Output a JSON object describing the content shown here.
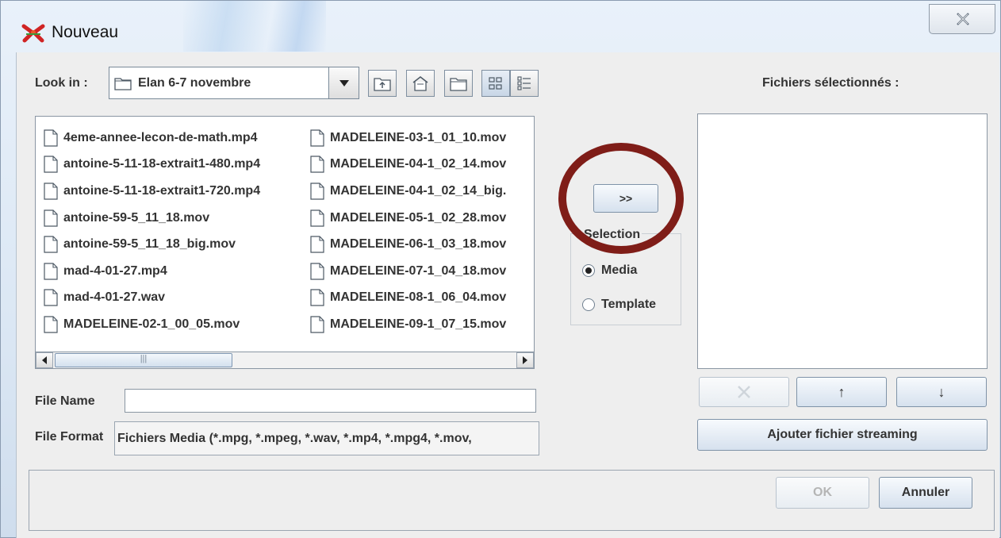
{
  "window": {
    "title": "Nouveau"
  },
  "look_in": {
    "label": "Look in :",
    "mnemonic": "i",
    "folder": "Elan 6-7 novembre"
  },
  "toolbar": {
    "up_icon": "up-folder-icon",
    "home_icon": "home-icon",
    "new_folder_icon": "new-folder-icon",
    "list_view_icon": "list-view-icon",
    "details_view_icon": "details-view-icon"
  },
  "files": {
    "column1": [
      "4eme-annee-lecon-de-math.mp4",
      "antoine-5-11-18-extrait1-480.mp4",
      "antoine-5-11-18-extrait1-720.mp4",
      "antoine-59-5_11_18.mov",
      "antoine-59-5_11_18_big.mov",
      "mad-4-01-27.mp4",
      "mad-4-01-27.wav",
      "MADELEINE-02-1_00_05.mov"
    ],
    "column2": [
      "MADELEINE-03-1_01_10.mov",
      "MADELEINE-04-1_02_14.mov",
      "MADELEINE-04-1_02_14_big.",
      "MADELEINE-05-1_02_28.mov",
      "MADELEINE-06-1_03_18.mov",
      "MADELEINE-07-1_04_18.mov",
      "MADELEINE-08-1_06_04.mov",
      "MADELEINE-09-1_07_15.mov"
    ]
  },
  "file_name": {
    "label": "File Name",
    "value": ""
  },
  "file_format": {
    "label": "File Format",
    "value": "Fichiers Media (*.mpg, *.mpeg, *.wav, *.mp4, *.mpg4, *.mov,"
  },
  "add_button": ">>",
  "selection": {
    "legend": "Selection",
    "options": [
      "Media",
      "Template"
    ],
    "selected": "Media"
  },
  "selected_files": {
    "label": "Fichiers sélectionnés :"
  },
  "list_buttons": {
    "up": "↑",
    "down": "↓",
    "streaming": "Ajouter fichier streaming"
  },
  "dialog_buttons": {
    "ok": "OK",
    "cancel": "Annuler"
  },
  "colors": {
    "highlight": "#7f1d18",
    "button_top": "#f7fafd",
    "button_bottom": "#d6e1ee"
  }
}
